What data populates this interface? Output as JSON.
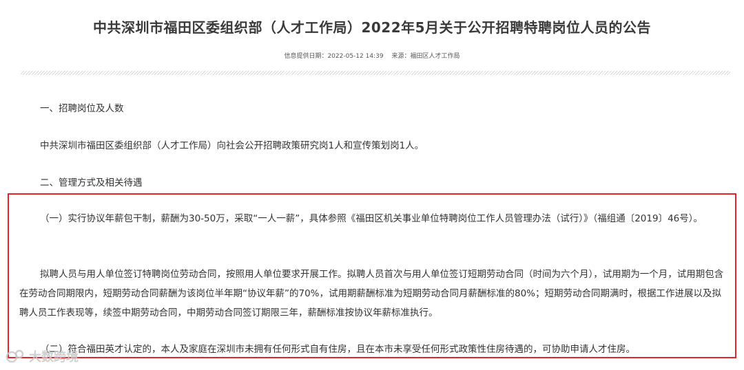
{
  "article": {
    "title": "中共深圳市福田区委组织部（人才工作局）2022年5月关于公开招聘特聘岗位人员的公告",
    "meta": {
      "date_label": "信息提供日期：2022-05-12 14:39",
      "source_label": "来源：福田区人才工作局"
    },
    "section1": {
      "heading": "一、招聘岗位及人数",
      "body": "中共深圳市福田区委组织部（人才工作局）向社会公开招聘政策研究岗1人和宣传策划岗1人。"
    },
    "section2": {
      "heading": "二、管理方式及相关待遇",
      "item1": "（一）实行协议年薪包干制，薪酬为30-50万，采取“一人一薪”，具体参照《福田区机关事业单位特聘岗位工作人员管理办法（试行）》（福组通〔2019〕46号）。",
      "item2": "拟聘人员与用人单位签订特聘岗位劳动合同，按照用人单位要求开展工作。拟聘人员首次与用人单位签订短期劳动合同（时间为六个月），试用期为一个月，试用期包含在劳动合同期限内，短期劳动合同薪酬为该岗位半年期“协议年薪”的70%，试用期薪酬标准为短期劳动合同月薪酬标准的80%；短期劳动合同期满时，根据工作进展以及拟聘人员工作表现等，续签中期劳动合同，中期劳动合同签订期限三年，薪酬标准按协议年薪标准执行。",
      "item3": "（二）符合福田英才认定的，本人及家庭在深圳市未拥有任何形式自有住房，且在本市未享受任何形式政策性住房待遇的，可协助申请人才住房。"
    }
  },
  "watermark": {
    "text": "大数跨境",
    "icon": "watermark-logo-icon"
  },
  "colors": {
    "highlight_border": "#e0262b",
    "text": "#333333",
    "title": "#3a3a3a"
  }
}
